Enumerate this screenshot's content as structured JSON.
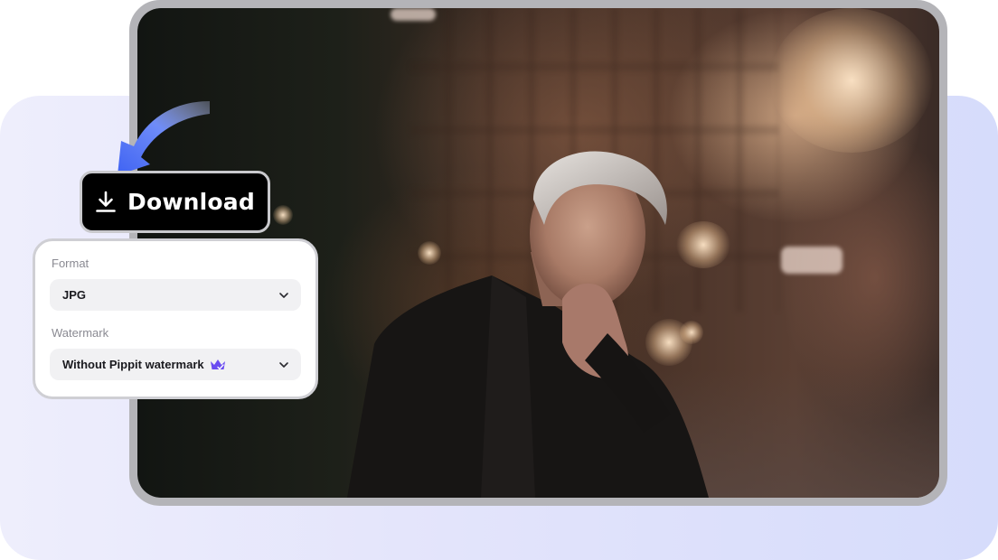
{
  "download_button": {
    "label": "Download",
    "icon": "download-icon"
  },
  "settings": {
    "format": {
      "label": "Format",
      "value": "JPG"
    },
    "watermark": {
      "label": "Watermark",
      "value": "Without Pippit watermark",
      "badge_icon": "crown-premium-icon"
    }
  },
  "colors": {
    "accent_blue": "#4a6cf7",
    "premium_purple": "#6a4cf0",
    "button_bg": "#000000"
  }
}
